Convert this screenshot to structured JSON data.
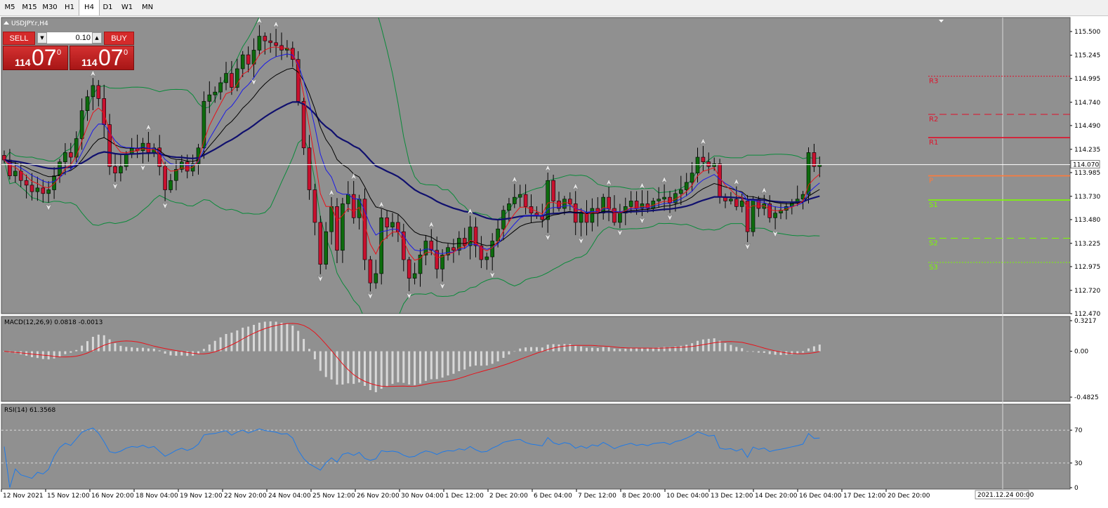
{
  "timeframes": [
    "M5",
    "M15",
    "M30",
    "H1",
    "H4",
    "D1",
    "W1",
    "MN"
  ],
  "active_timeframe": "H4",
  "colors": {
    "background": "#909090",
    "bull": "#0d6b0d",
    "bear": "#c8102e",
    "ema_fast": "#e8121a",
    "ema_mid": "#1a1ae8",
    "ema_slow": "#000000",
    "ma_long": "#10106e",
    "bollinger": "#0a8a3a",
    "macd_hist": "#d8d8d8",
    "macd_signal": "#e8121a",
    "rsi": "#1e7ae8",
    "pivot_r": "#e0102a",
    "pivot_p": "#ff7a3a",
    "pivot_s": "#7cfc00"
  },
  "trade_panel": {
    "sell_label": "SELL",
    "buy_label": "BUY",
    "lot": "0.10",
    "sell_price_small": "114",
    "sell_price_big": "07",
    "sell_price_sup": "0",
    "buy_price_small": "114",
    "buy_price_big": "07",
    "buy_price_sup": "0"
  },
  "chart_data": [
    {
      "type": "candlestick",
      "title": "USDJPY.r,H4",
      "ylim": [
        112.47,
        115.65
      ],
      "y_ticks": [
        "115.500",
        "115.245",
        "114.995",
        "114.740",
        "114.490",
        "114.235",
        "113.985",
        "113.730",
        "113.480",
        "113.225",
        "112.975",
        "112.720",
        "112.470"
      ],
      "current_price": "114.070",
      "x_labels": [
        "12 Nov 2021",
        "15 Nov 12:00",
        "16 Nov 20:00",
        "18 Nov 04:00",
        "19 Nov 12:00",
        "22 Nov 20:00",
        "24 Nov 04:00",
        "25 Nov 12:00",
        "26 Nov 20:00",
        "30 Nov 04:00",
        "1 Dec 12:00",
        "2 Dec 20:00",
        "6 Dec 04:00",
        "7 Dec 12:00",
        "8 Dec 20:00",
        "10 Dec 04:00",
        "13 Dec 12:00",
        "14 Dec 20:00",
        "16 Dec 04:00",
        "17 Dec 12:00",
        "20 Dec 20:00",
        "2021.12.24 00:00"
      ],
      "close": [
        114.12,
        113.95,
        114.0,
        113.9,
        113.85,
        113.78,
        113.82,
        113.76,
        113.8,
        113.95,
        114.1,
        114.2,
        114.15,
        114.35,
        114.65,
        114.8,
        114.92,
        114.78,
        114.5,
        114.05,
        113.98,
        114.05,
        114.18,
        114.25,
        114.22,
        114.3,
        114.2,
        114.25,
        114.05,
        113.8,
        113.9,
        114.02,
        114.1,
        114.0,
        114.08,
        114.25,
        114.75,
        114.82,
        114.85,
        114.95,
        115.05,
        114.9,
        115.1,
        115.25,
        115.15,
        115.3,
        115.45,
        115.4,
        115.38,
        115.35,
        115.3,
        115.32,
        115.2,
        114.75,
        114.25,
        113.8,
        113.45,
        113.0,
        113.35,
        113.62,
        113.15,
        113.65,
        113.75,
        113.5,
        113.7,
        113.05,
        112.8,
        112.9,
        113.5,
        113.4,
        113.45,
        113.35,
        113.05,
        112.85,
        112.9,
        113.1,
        113.25,
        113.15,
        112.95,
        113.1,
        113.18,
        113.15,
        113.28,
        113.2,
        113.4,
        113.2,
        113.05,
        113.08,
        113.25,
        113.38,
        113.58,
        113.65,
        113.72,
        113.75,
        113.62,
        113.55,
        113.52,
        113.48,
        113.9,
        113.68,
        113.6,
        113.7,
        113.65,
        113.45,
        113.55,
        113.45,
        113.6,
        113.55,
        113.72,
        113.6,
        113.45,
        113.55,
        113.62,
        113.68,
        113.6,
        113.65,
        113.6,
        113.68,
        113.7,
        113.72,
        113.66,
        113.76,
        113.8,
        113.88,
        113.98,
        114.15,
        114.1,
        114.05,
        114.08,
        113.72,
        113.68,
        113.7,
        113.62,
        113.68,
        113.35,
        113.7,
        113.6,
        113.65,
        113.5,
        113.55,
        113.58,
        113.62,
        113.66,
        113.7,
        113.75,
        114.2,
        114.05,
        114.07
      ]
    },
    {
      "type": "bar",
      "title": "MACD(12,26,9) 0.0818 -0.0013",
      "ylim": [
        -0.4825,
        0.3217
      ],
      "y_ticks": [
        "0.3217",
        "0.00",
        "-0.4825"
      ]
    },
    {
      "type": "line",
      "title": "RSI(14) 61.3568",
      "ylim": [
        0,
        100
      ],
      "y_ticks": [
        "70",
        "30",
        "0"
      ],
      "levels": [
        70,
        30
      ]
    }
  ],
  "pivots": [
    {
      "name": "R3",
      "price": 115.02,
      "style": "dot",
      "role": "r"
    },
    {
      "name": "R2",
      "price": 114.61,
      "style": "dash",
      "role": "r"
    },
    {
      "name": "R1",
      "price": 114.36,
      "style": "solid",
      "role": "r"
    },
    {
      "name": "P",
      "price": 113.95,
      "style": "solid",
      "role": "p"
    },
    {
      "name": "S1",
      "price": 113.69,
      "style": "solid",
      "role": "s"
    },
    {
      "name": "S2",
      "price": 113.28,
      "style": "dash",
      "role": "s"
    },
    {
      "name": "S3",
      "price": 113.02,
      "style": "dot",
      "role": "s"
    }
  ]
}
